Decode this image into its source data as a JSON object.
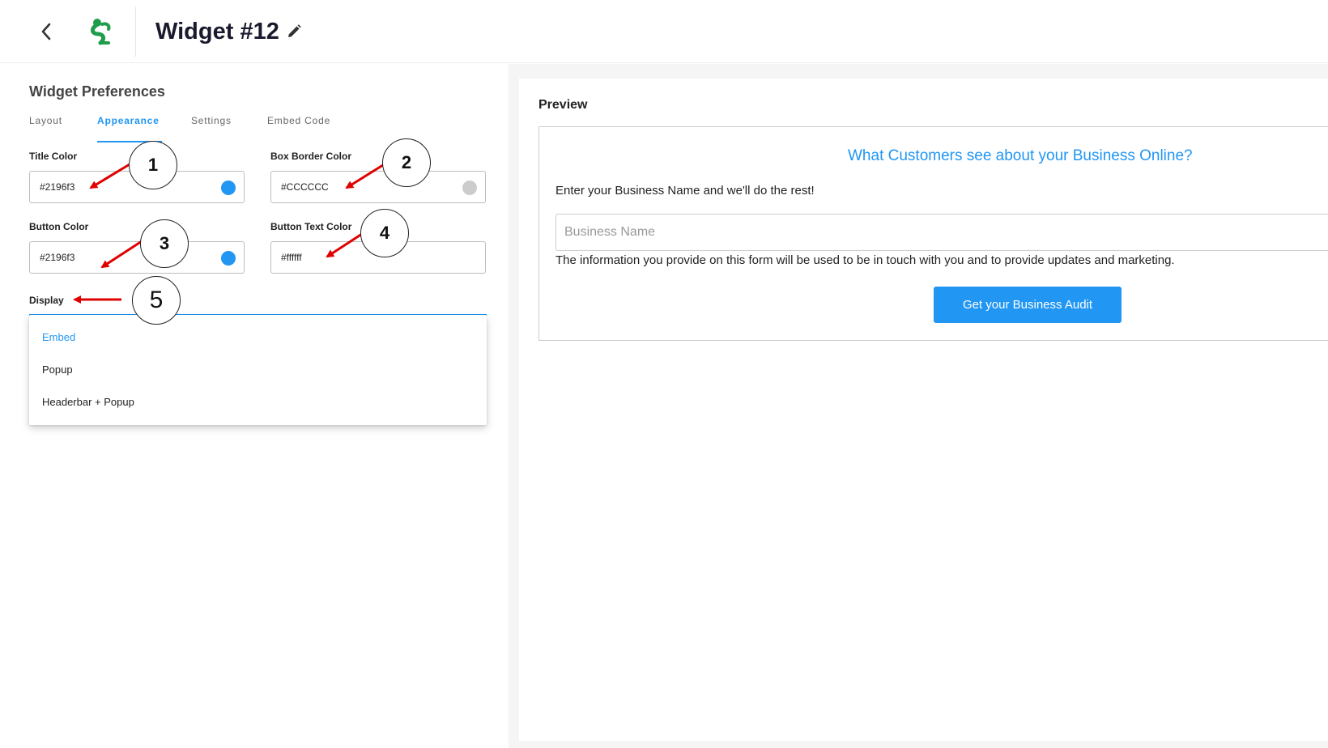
{
  "header": {
    "title": "Widget #12",
    "back_icon": "chevron-left-icon",
    "logo_icon": "app-logo-icon",
    "edit_icon": "pencil-icon"
  },
  "preferences": {
    "title": "Widget Preferences",
    "tabs": [
      {
        "label": "Layout",
        "active": false
      },
      {
        "label": "Appearance",
        "active": true
      },
      {
        "label": "Settings",
        "active": false
      },
      {
        "label": "Embed Code",
        "active": false
      }
    ],
    "fields": {
      "title_color": {
        "label": "Title Color",
        "value": "#2196f3",
        "swatch": "#2196f3"
      },
      "box_border_color": {
        "label": "Box Border Color",
        "value": "#CCCCCC",
        "swatch": "#cccccc"
      },
      "button_color": {
        "label": "Button Color",
        "value": "#2196f3",
        "swatch": "#2196f3"
      },
      "button_text_color": {
        "label": "Button Text Color",
        "value": "#ffffff"
      }
    },
    "display": {
      "label": "Display",
      "options": [
        "Embed",
        "Popup",
        "Headerbar + Popup"
      ],
      "selected": "Embed"
    }
  },
  "annotations": [
    "1",
    "2",
    "3",
    "4",
    "5"
  ],
  "preview": {
    "title": "Preview",
    "form": {
      "heading": "What Customers see about your Business Online?",
      "intro": "Enter your Business Name and we'll do the rest!",
      "input_placeholder": "Business Name",
      "disclaimer": "The information you provide on this form will be used to be in touch with you and to provide updates and marketing.",
      "button_label": "Get your Business Audit"
    }
  },
  "colors": {
    "accent": "#2196f3",
    "arrow": "#e00000",
    "border": "#cccccc"
  }
}
